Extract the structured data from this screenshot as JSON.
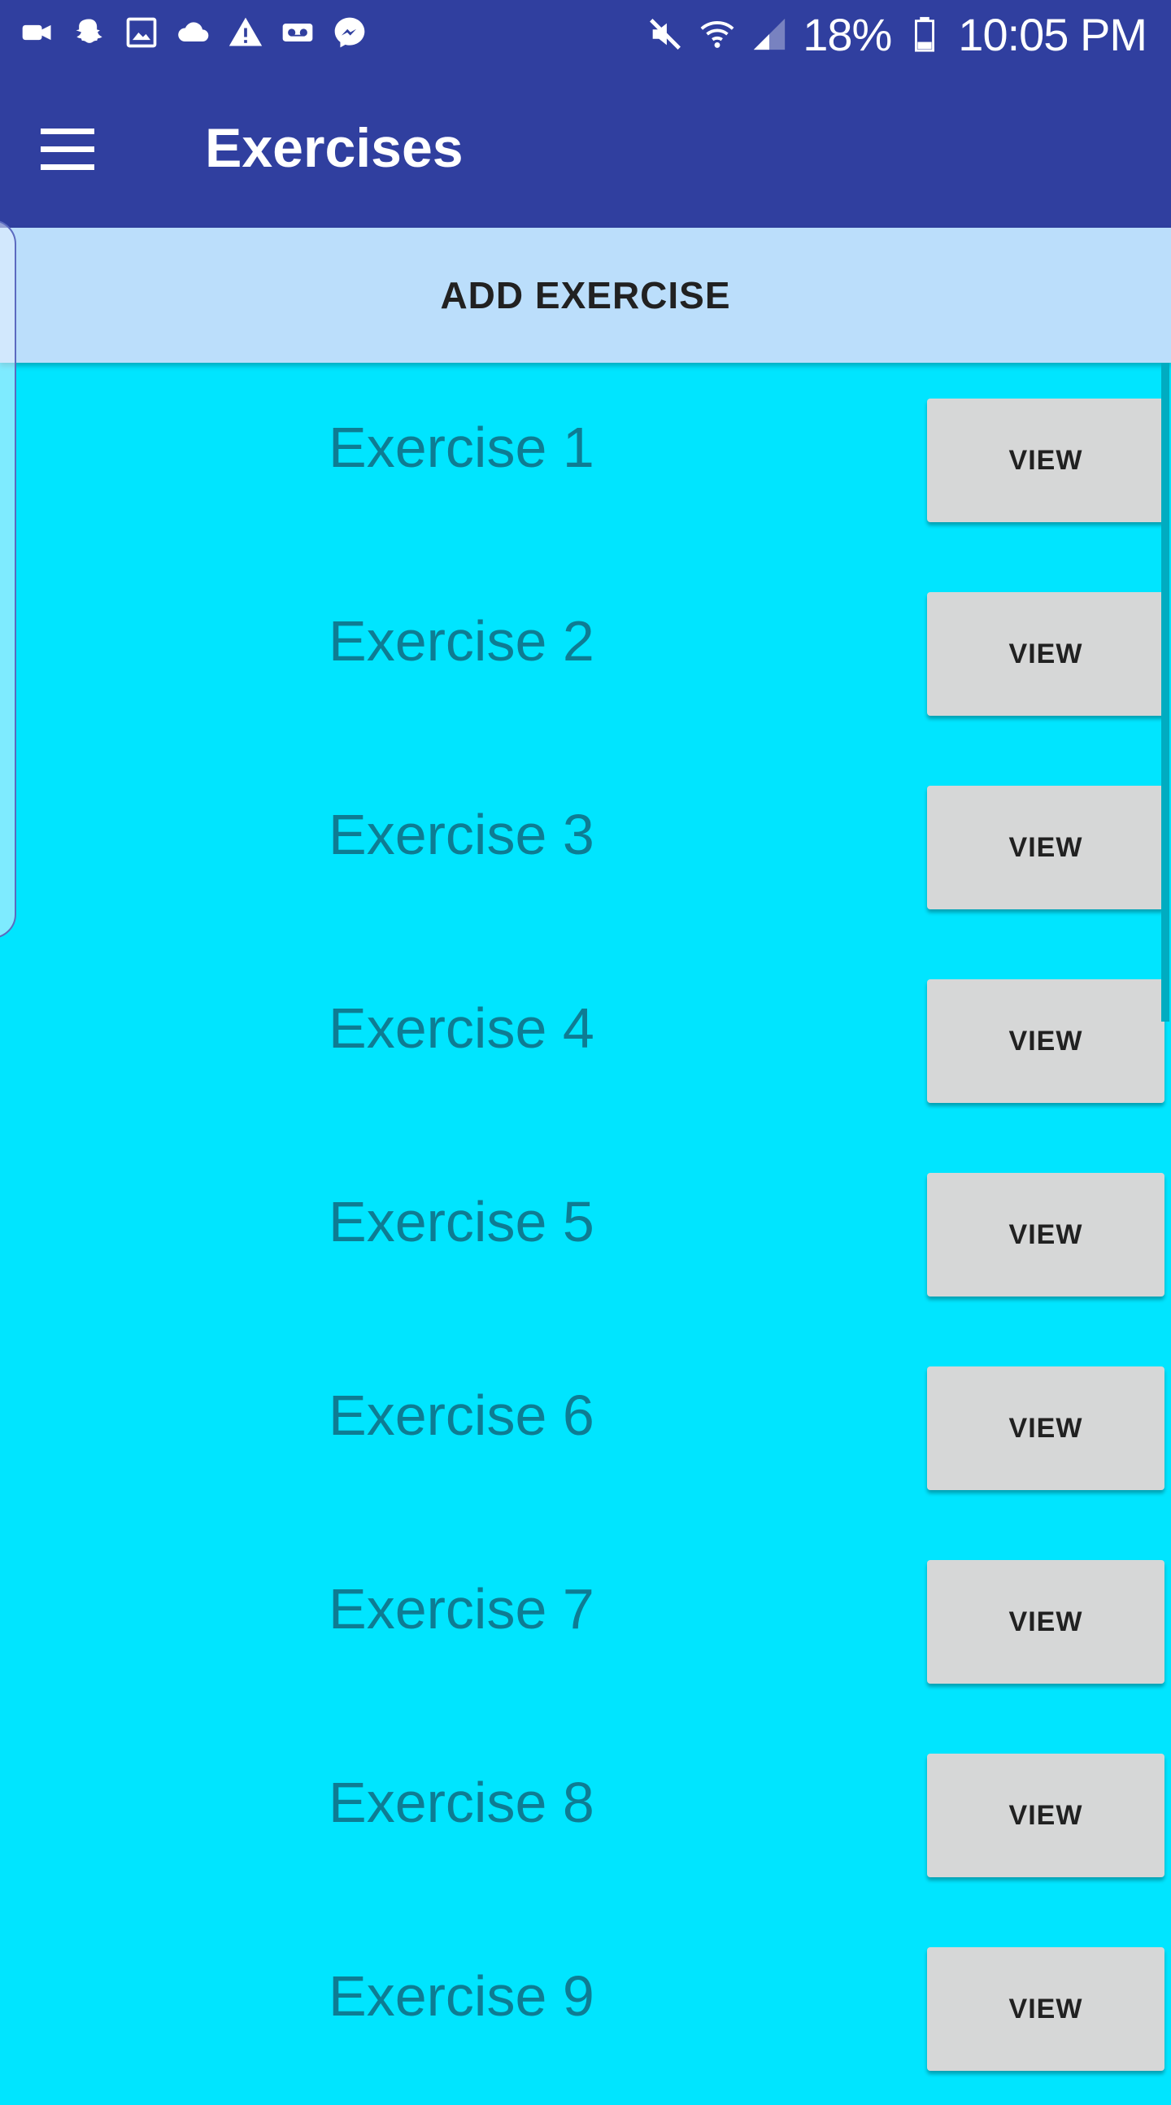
{
  "colors": {
    "primary": "#303F9F",
    "add_bar": "#BBDEFB",
    "list_bg": "#00E5FF",
    "label": "#0E7C93",
    "button": "#D6D7D7"
  },
  "status_bar": {
    "battery_percent": "18%",
    "time": "10:05 PM",
    "left_icons": [
      "video-icon",
      "snapchat-icon",
      "image-icon",
      "cloud-icon",
      "warning-icon",
      "voicemail-icon",
      "messenger-icon"
    ],
    "right_icons": [
      "mute-icon",
      "wifi-icon",
      "signal-icon",
      "battery-icon"
    ]
  },
  "app_bar": {
    "title": "Exercises",
    "menu_icon": "hamburger-menu-icon"
  },
  "add_button": {
    "label": "ADD EXERCISE"
  },
  "exercises": [
    {
      "label": "Exercise 1",
      "button": "VIEW"
    },
    {
      "label": "Exercise 2",
      "button": "VIEW"
    },
    {
      "label": "Exercise 3",
      "button": "VIEW"
    },
    {
      "label": "Exercise 4",
      "button": "VIEW"
    },
    {
      "label": "Exercise 5",
      "button": "VIEW"
    },
    {
      "label": "Exercise 6",
      "button": "VIEW"
    },
    {
      "label": "Exercise 7",
      "button": "VIEW"
    },
    {
      "label": "Exercise 8",
      "button": "VIEW"
    },
    {
      "label": "Exercise 9",
      "button": "VIEW"
    }
  ]
}
